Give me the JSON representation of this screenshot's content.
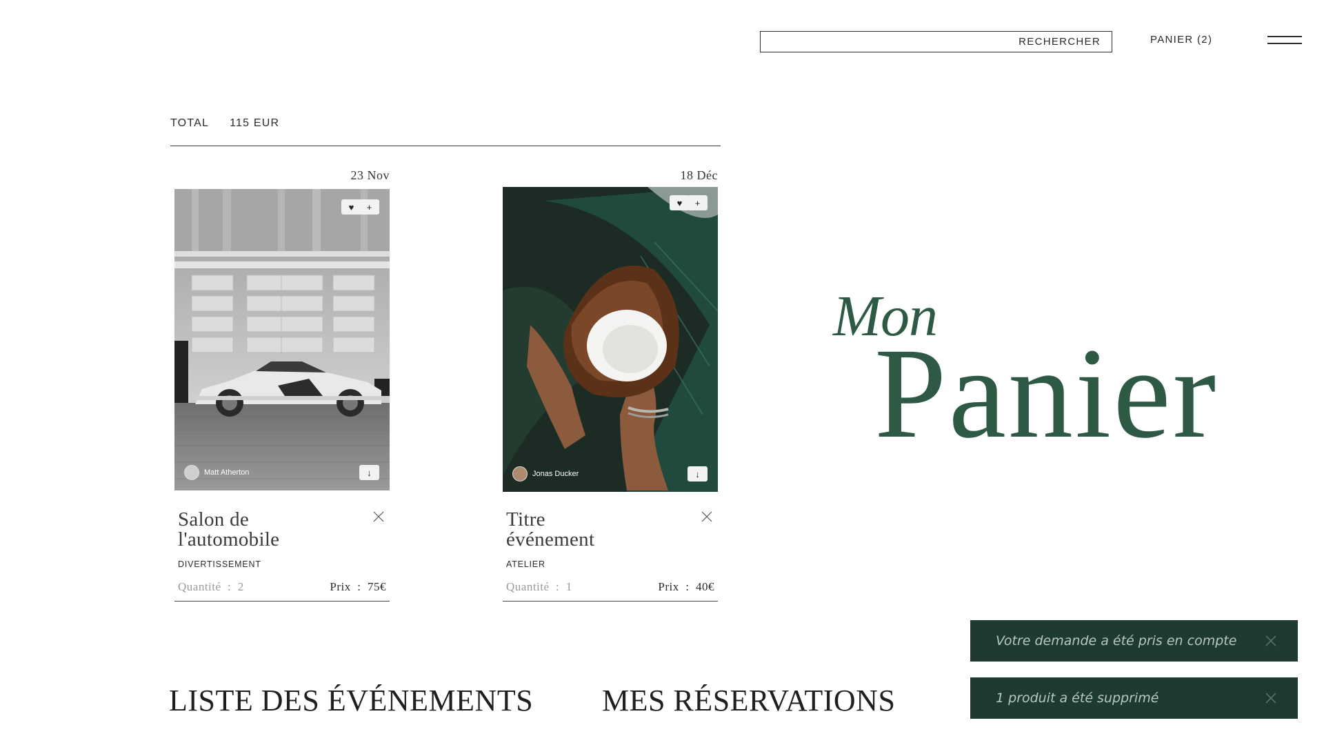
{
  "header": {
    "search_placeholder": "",
    "search_button": "RECHERCHER",
    "cart_label": "PANIER (2)"
  },
  "summary": {
    "total_label": "TOTAL",
    "total_value": "115 EUR"
  },
  "cart_items": [
    {
      "date": "23 Nov",
      "title_line1": "Salon de",
      "title_line2": "l'automobile",
      "category": "DIVERTISSEMENT",
      "author": "Matt Atherton",
      "quantity_label": "Quantité",
      "quantity_value": "2",
      "price_label": "Prix",
      "price_value": "75€"
    },
    {
      "date": "18 Déc",
      "title_line1": "Titre",
      "title_line2": "événement",
      "category": "ATELIER",
      "author": "Jonas Ducker",
      "quantity_label": "Quantité",
      "quantity_value": "1",
      "price_label": "Prix",
      "price_value": "40€"
    }
  ],
  "page_title": {
    "line1": "Mon",
    "line2": "Panier"
  },
  "footer_nav": {
    "events_link": "LISTE DES ÉVÉNEMENTS",
    "reservations_link": "MES RÉSERVATIONS"
  },
  "toasts": [
    {
      "message": "Votre demande a été pris en compte"
    },
    {
      "message": "1 produit a été supprimé"
    }
  ],
  "colors": {
    "brand_green": "#2e5a45",
    "toast_bg": "#1e3a31"
  }
}
